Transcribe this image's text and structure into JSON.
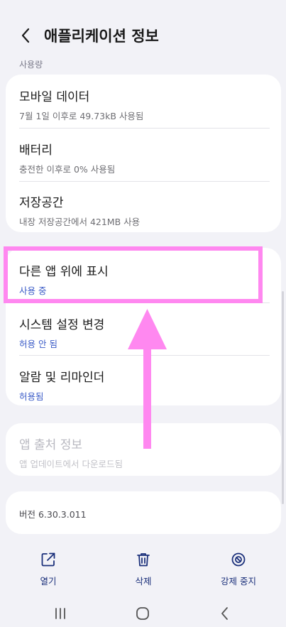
{
  "header": {
    "title": "애플리케이션 정보"
  },
  "usage_section": {
    "label": "사용량",
    "items": [
      {
        "title": "모바일 데이터",
        "subtitle": "7월 1일 이후로 49.73kB 사용됨"
      },
      {
        "title": "배터리",
        "subtitle": "충전한 이후로 0% 사용됨"
      },
      {
        "title": "저장공간",
        "subtitle": "내장 저장공간에서 421MB 사용"
      }
    ]
  },
  "permissions_section": {
    "items": [
      {
        "title": "다른 앱 위에 표시",
        "subtitle": "사용 중"
      },
      {
        "title": "시스템 설정 변경",
        "subtitle": "허용 안 됨"
      },
      {
        "title": "알람 및 리마인더",
        "subtitle": "허용됨"
      }
    ]
  },
  "source_section": {
    "title": "앱 출처 정보",
    "subtitle": "앱 업데이트에서 다운로드됨"
  },
  "version": {
    "text": "버전 6.30.3.011"
  },
  "actions": [
    {
      "label": "열기",
      "icon": "open-external-icon"
    },
    {
      "label": "삭제",
      "icon": "trash-icon"
    },
    {
      "label": "강제 중지",
      "icon": "force-stop-icon"
    }
  ],
  "nav": {
    "recents_icon": "recents-icon",
    "home_icon": "home-icon",
    "back_icon": "back-icon"
  },
  "colors": {
    "accent_blue": "#3a5bc7",
    "highlight_pink": "#ff88f0",
    "background": "#f2f2f7"
  }
}
